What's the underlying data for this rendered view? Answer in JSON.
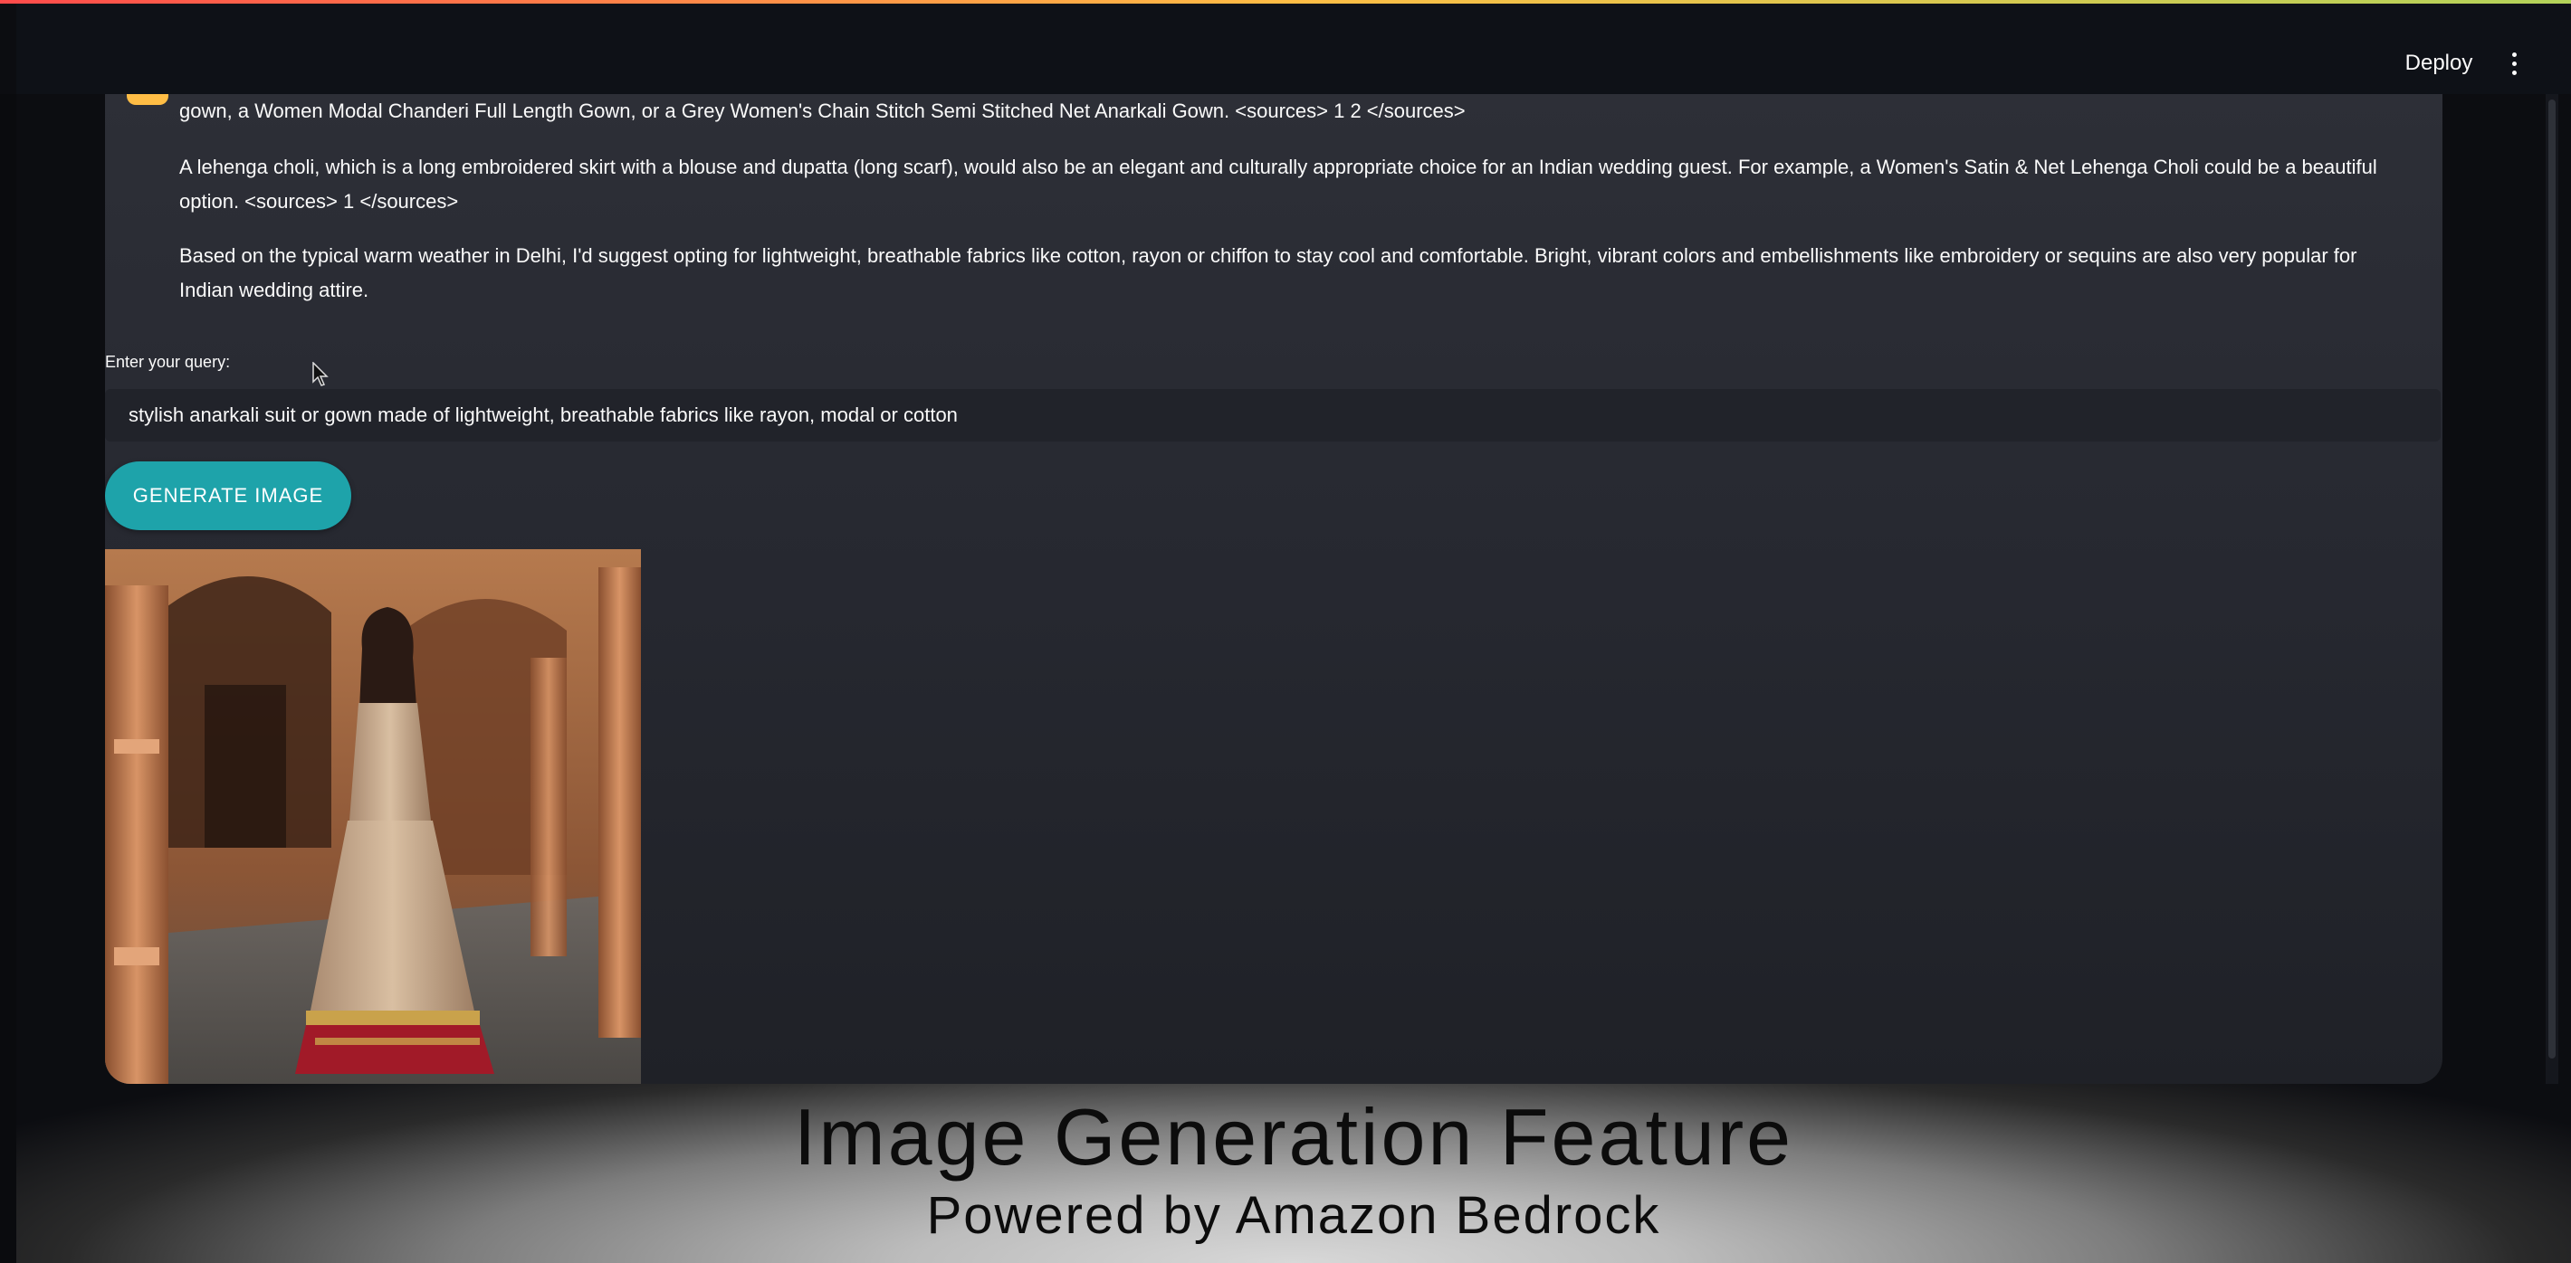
{
  "header": {
    "deploy_label": "Deploy",
    "menu_icon": "more-vertical-icon"
  },
  "chat": {
    "paragraphs": [
      "gown, a Women Modal Chanderi Full Length Gown, or a Grey Women's Chain Stitch Semi Stitched Net Anarkali Gown. <sources> 1 2 </sources>",
      "A lehenga choli, which is a long embroidered skirt with a blouse and dupatta (long scarf), would also be an elegant and culturally appropriate choice for an Indian wedding guest. For example, a Women's Satin & Net Lehenga Choli could be a beautiful option. <sources> 1 </sources>",
      "Based on the typical warm weather in Delhi, I'd suggest opting for lightweight, breathable fabrics like cotton, rayon or chiffon to stay cool and comfortable. Bright, vibrant colors and embellishments like embroidery or sequins are also very popular for Indian wedding attire."
    ]
  },
  "query": {
    "label": "Enter your query:",
    "value": "stylish anarkali suit or gown made of lightweight, breathable fabrics like rayon, modal or cotton"
  },
  "generate_button_label": "GENERATE IMAGE",
  "banner": {
    "title": "Image Generation Feature",
    "subtitle": "Powered by Amazon Bedrock"
  },
  "colors": {
    "accent_button": "#1ea3aa",
    "avatar": "#ffbd45",
    "panel_bg": "#2d2f37",
    "page_bg": "#0e1117"
  }
}
